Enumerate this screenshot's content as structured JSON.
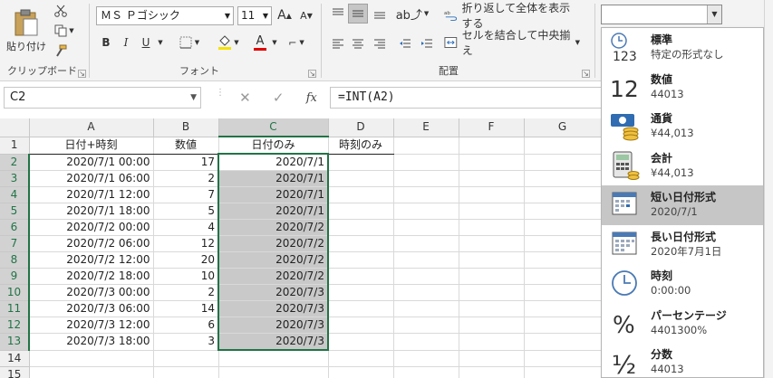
{
  "ribbon": {
    "clipboard": {
      "paste_label": "貼り付け",
      "group_label": "クリップボード"
    },
    "font": {
      "font_name": "ＭＳ Ｐゴシック",
      "font_size": "11",
      "bold": "B",
      "italic": "I",
      "underline": "U",
      "grow": "A",
      "shrink": "A",
      "group_label": "フォント"
    },
    "alignment": {
      "wrap_label": "折り返して全体を表示する",
      "merge_label": "セルを結合して中央揃え",
      "group_label": "配置"
    },
    "number": {
      "format_value": ""
    }
  },
  "formula_bar": {
    "name_box": "C2",
    "fx": "fx",
    "cancel": "✕",
    "enter": "✓",
    "formula": "=INT(A2)"
  },
  "sheet": {
    "columns": [
      "A",
      "B",
      "C",
      "D",
      "E",
      "F",
      "G"
    ],
    "headers": [
      "日付+時刻",
      "数値",
      "日付のみ",
      "時刻のみ"
    ],
    "rows": [
      {
        "num": "2",
        "a": "2020/7/1  00:00",
        "b": "17",
        "c": "2020/7/1"
      },
      {
        "num": "3",
        "a": "2020/7/1  06:00",
        "b": "2",
        "c": "2020/7/1"
      },
      {
        "num": "4",
        "a": "2020/7/1  12:00",
        "b": "7",
        "c": "2020/7/1"
      },
      {
        "num": "5",
        "a": "2020/7/1  18:00",
        "b": "5",
        "c": "2020/7/1"
      },
      {
        "num": "6",
        "a": "2020/7/2  00:00",
        "b": "4",
        "c": "2020/7/2"
      },
      {
        "num": "7",
        "a": "2020/7/2  06:00",
        "b": "12",
        "c": "2020/7/2"
      },
      {
        "num": "8",
        "a": "2020/7/2  12:00",
        "b": "20",
        "c": "2020/7/2"
      },
      {
        "num": "9",
        "a": "2020/7/2  18:00",
        "b": "10",
        "c": "2020/7/2"
      },
      {
        "num": "10",
        "a": "2020/7/3  00:00",
        "b": "2",
        "c": "2020/7/3"
      },
      {
        "num": "11",
        "a": "2020/7/3  06:00",
        "b": "14",
        "c": "2020/7/3"
      },
      {
        "num": "12",
        "a": "2020/7/3  12:00",
        "b": "6",
        "c": "2020/7/3"
      },
      {
        "num": "13",
        "a": "2020/7/3  18:00",
        "b": "3",
        "c": "2020/7/3"
      }
    ],
    "row1": "1",
    "row14": "14",
    "row15": "15"
  },
  "number_format_menu": {
    "items": [
      {
        "title": "標準",
        "sample": "特定の形式なし",
        "icon": "clock-123-icon",
        "icon_text": "123"
      },
      {
        "title": "数値",
        "sample": "44013",
        "icon": "number-12-icon",
        "icon_text": "12"
      },
      {
        "title": "通貨",
        "sample": "¥44,013",
        "icon": "currency-icon"
      },
      {
        "title": "会計",
        "sample": "¥44,013",
        "icon": "calculator-icon"
      },
      {
        "title": "短い日付形式",
        "sample": "2020/7/1",
        "icon": "calendar-short-icon"
      },
      {
        "title": "長い日付形式",
        "sample": "2020年7月1日",
        "icon": "calendar-long-icon"
      },
      {
        "title": "時刻",
        "sample": "0:00:00",
        "icon": "clock-icon"
      },
      {
        "title": "パーセンテージ",
        "sample": "4401300%",
        "icon": "percent-icon",
        "icon_text": "%"
      },
      {
        "title": "分数",
        "sample": "44013",
        "icon": "fraction-icon",
        "icon_text": "½"
      }
    ],
    "active_index": 4
  },
  "colors": {
    "accent": "#217346",
    "selection": "#c9c9c9"
  }
}
